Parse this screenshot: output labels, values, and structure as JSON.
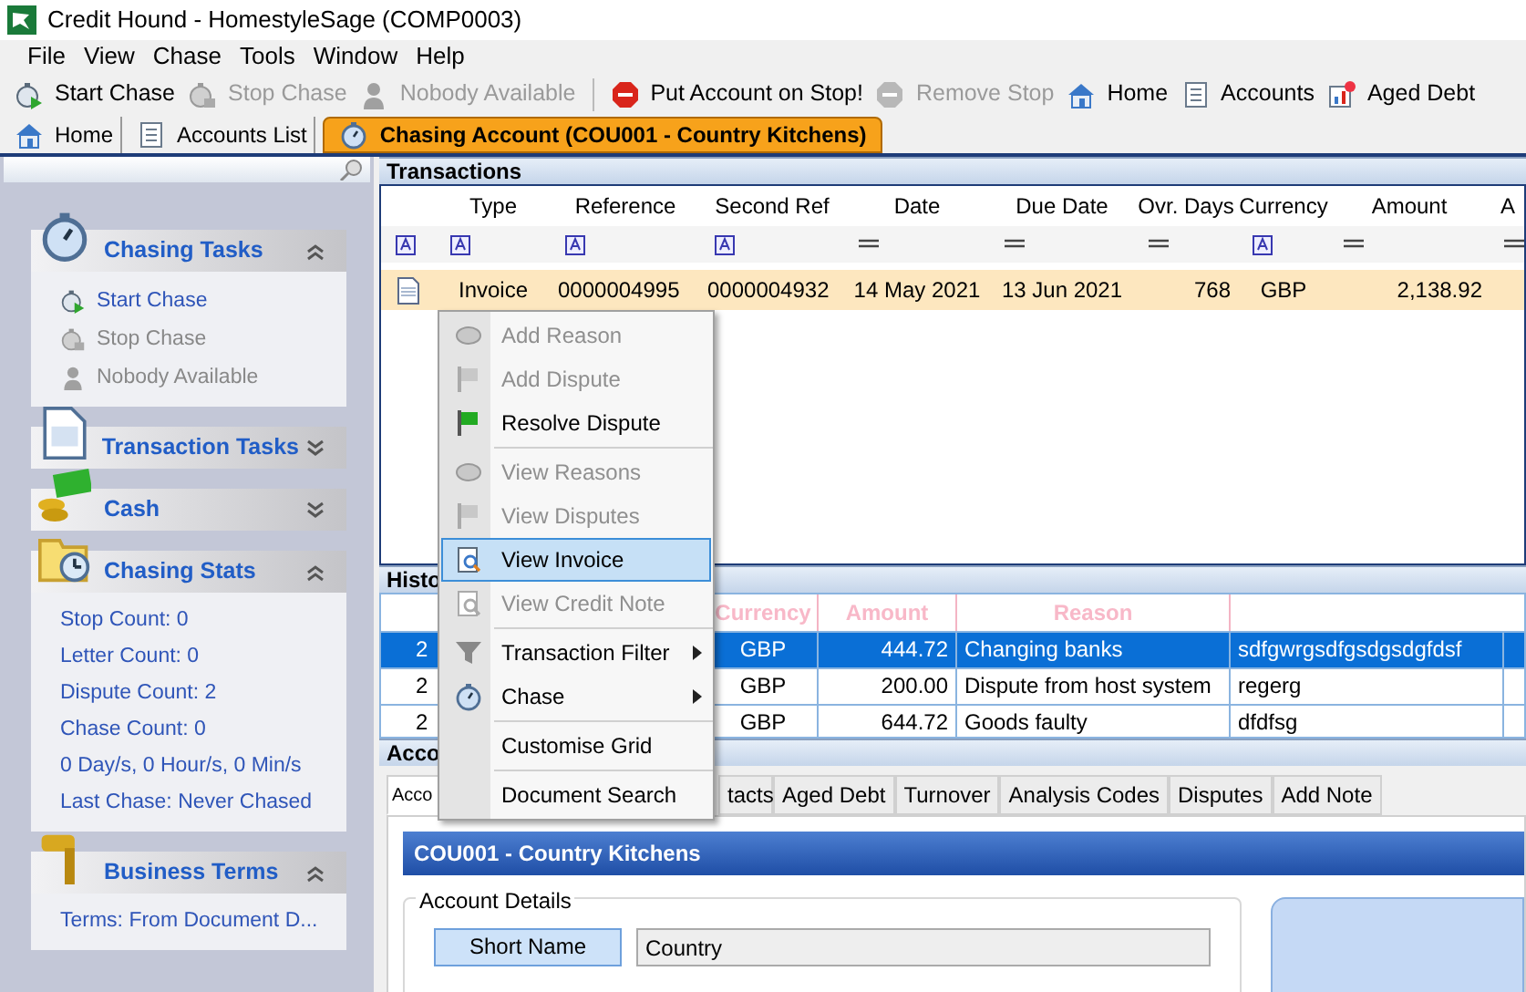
{
  "window": {
    "title": "Credit Hound - HomestyleSage (COMP0003)"
  },
  "menu": [
    "File",
    "View",
    "Chase",
    "Tools",
    "Window",
    "Help"
  ],
  "toolbar": [
    {
      "kind": "start",
      "label": "Start Chase",
      "disabled": false
    },
    {
      "kind": "stop",
      "label": "Stop Chase",
      "disabled": true
    },
    {
      "kind": "person",
      "label": "Nobody Available",
      "disabled": true
    },
    {
      "kind": "separator"
    },
    {
      "kind": "stopsign",
      "label": "Put Account on Stop!",
      "disabled": false
    },
    {
      "kind": "stopsign",
      "label": "Remove Stop",
      "disabled": true
    },
    {
      "kind": "home",
      "label": "Home",
      "disabled": false
    },
    {
      "kind": "list",
      "label": "Accounts",
      "disabled": false
    },
    {
      "kind": "chart",
      "label": "Aged Debt",
      "disabled": false
    }
  ],
  "doc_tabs": [
    {
      "kind": "home",
      "label": "Home",
      "selected": false
    },
    {
      "kind": "list",
      "label": "Accounts List",
      "selected": false
    },
    {
      "kind": "watch",
      "label": "Chasing Account (COU001 - Country Kitchens)",
      "selected": true
    }
  ],
  "sidebar": [
    {
      "kind": "watch",
      "title": "Chasing Tasks",
      "expanded": true,
      "items": [
        {
          "kind": "start",
          "label": "Start Chase",
          "disabled": false
        },
        {
          "kind": "stop",
          "label": "Stop Chase",
          "disabled": true
        },
        {
          "kind": "person",
          "label": "Nobody Available",
          "disabled": true
        }
      ]
    },
    {
      "kind": "document",
      "title": "Transaction Tasks",
      "expanded": false
    },
    {
      "kind": "cash",
      "title": "Cash",
      "expanded": false
    },
    {
      "kind": "folder",
      "title": "Chasing Stats",
      "expanded": true,
      "items": [
        {
          "kind": "text",
          "label": "Stop Count: 0"
        },
        {
          "kind": "text",
          "label": "Letter Count: 0"
        },
        {
          "kind": "text",
          "label": "Dispute Count: 2"
        },
        {
          "kind": "text",
          "label": "Chase Count: 0"
        },
        {
          "kind": "text",
          "label": "0 Day/s, 0 Hour/s, 0 Min/s"
        },
        {
          "kind": "text",
          "label": "Last Chase: Never Chased"
        }
      ]
    },
    {
      "kind": "gavel",
      "title": "Business Terms",
      "expanded": true,
      "items": [
        {
          "kind": "text",
          "label": "Terms: From Document D..."
        }
      ]
    }
  ],
  "transactions": {
    "title": "Transactions",
    "columns": [
      "Type",
      "Reference",
      "Second Ref",
      "Date",
      "Due Date",
      "Ovr. Days",
      "Currency",
      "Amount",
      "A"
    ],
    "filters": [
      {
        "kind": "text"
      },
      {
        "kind": "text"
      },
      {
        "kind": "text"
      },
      {
        "kind": "text"
      },
      {
        "kind": "value"
      },
      {
        "kind": "value"
      },
      {
        "kind": "value"
      },
      {
        "kind": "text"
      },
      {
        "kind": "value"
      },
      {
        "kind": "value"
      }
    ],
    "rows": [
      {
        "selected": true,
        "cells": [
          "Invoice",
          "0000004995",
          "0000004932",
          "14 May 2021",
          "13 Jun 2021",
          "768",
          "GBP",
          "2,138.92"
        ]
      }
    ]
  },
  "history": {
    "title": "Histo",
    "columns": [
      "",
      "Currency",
      "Amount",
      "Reason"
    ],
    "rows": [
      {
        "selected": true,
        "cells": [
          "2",
          "GBP",
          "444.72",
          "Changing banks",
          "sdfgwrgsdfgsdgsdgfdsf"
        ]
      },
      {
        "selected": false,
        "cells": [
          "2",
          "GBP",
          "200.00",
          "Dispute from host system",
          "regerg"
        ]
      },
      {
        "selected": false,
        "cells": [
          "2",
          "GBP",
          "644.72",
          "Goods faulty",
          "dfdfsg"
        ]
      }
    ]
  },
  "account": {
    "title": "Acco",
    "tabs": [
      {
        "label": "Acco",
        "selected": true
      },
      {
        "label": "tacts",
        "selected": false
      },
      {
        "label": "Aged Debt",
        "selected": false
      },
      {
        "label": "Turnover",
        "selected": false
      },
      {
        "label": "Analysis Codes",
        "selected": false
      },
      {
        "label": "Disputes",
        "selected": false
      },
      {
        "label": "Add Note",
        "selected": false
      }
    ],
    "banner": "COU001 - Country Kitchens",
    "group": "Account Details",
    "fields": [
      {
        "label": "Short Name",
        "value": "Country"
      }
    ]
  },
  "context_menu": [
    {
      "kind": "reason",
      "label": "Add Reason",
      "disabled": true,
      "selected": false
    },
    {
      "kind": "flag",
      "label": "Add Dispute",
      "disabled": true,
      "selected": false
    },
    {
      "kind": "flag",
      "label": "Resolve Dispute",
      "disabled": false,
      "selected": false
    },
    {
      "kind": "separator"
    },
    {
      "kind": "reason",
      "label": "View Reasons",
      "disabled": true,
      "selected": false
    },
    {
      "kind": "flag",
      "label": "View Disputes",
      "disabled": true,
      "selected": false
    },
    {
      "kind": "doc",
      "label": "View Invoice",
      "disabled": false,
      "selected": true
    },
    {
      "kind": "doc",
      "label": "View Credit Note",
      "disabled": true,
      "selected": false
    },
    {
      "kind": "separator"
    },
    {
      "kind": "filter",
      "label": "Transaction Filter",
      "disabled": false,
      "selected": false,
      "submenu": true
    },
    {
      "kind": "watch",
      "label": "Chase",
      "disabled": false,
      "selected": false,
      "submenu": true
    },
    {
      "kind": "separator"
    },
    {
      "kind": "plain",
      "label": "Customise Grid",
      "disabled": false,
      "selected": false
    },
    {
      "kind": "separator"
    },
    {
      "kind": "plain",
      "label": "Document Search",
      "disabled": false,
      "selected": false
    }
  ]
}
